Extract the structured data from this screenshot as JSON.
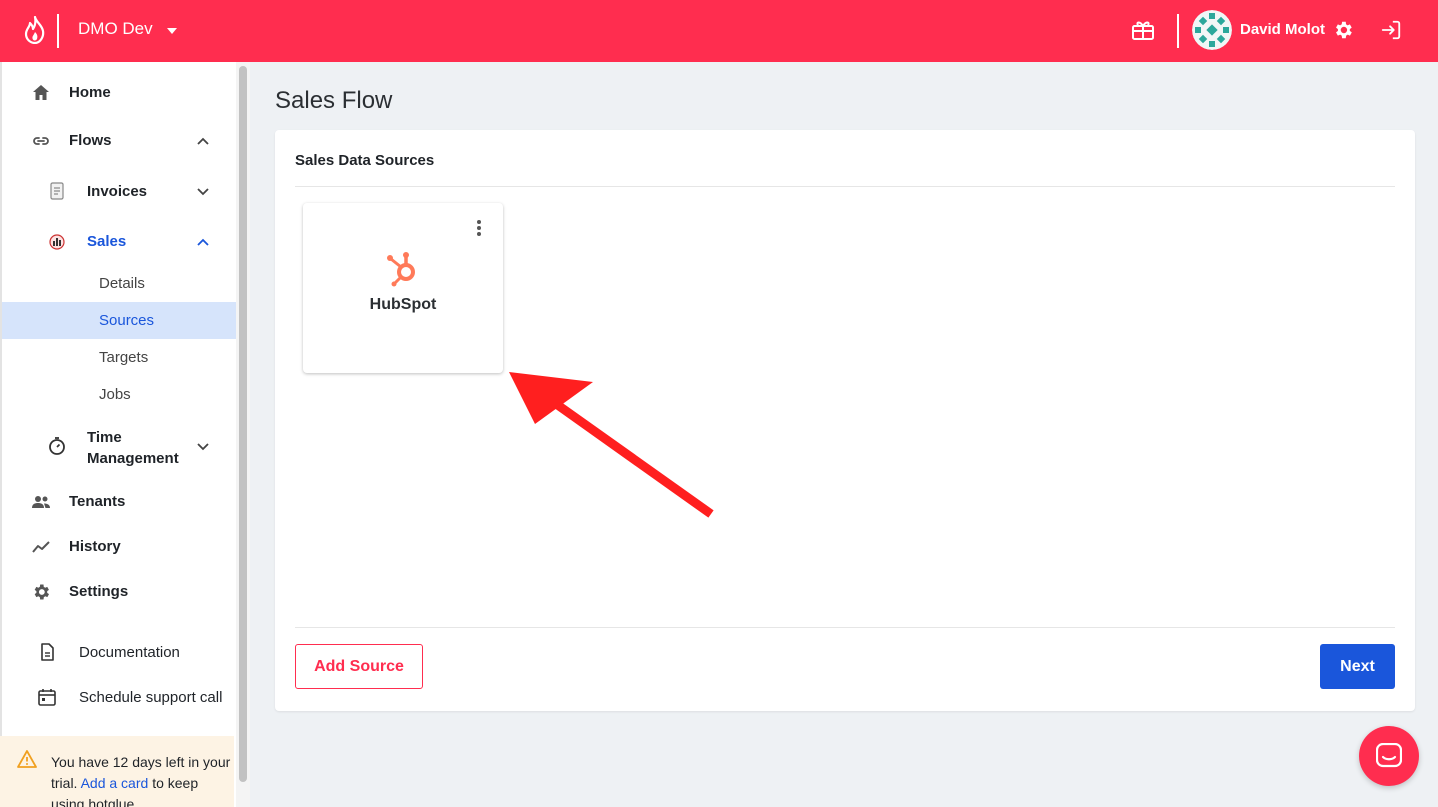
{
  "topbar": {
    "workspace": "DMO Dev",
    "user_name": "David Molot",
    "brand_color": "#ff2d4f"
  },
  "sidebar": {
    "home": "Home",
    "flows": "Flows",
    "invoices": "Invoices",
    "sales": "Sales",
    "sales_sub": [
      "Details",
      "Sources",
      "Targets",
      "Jobs"
    ],
    "active_sub": "Sources",
    "time_management_line1": "Time",
    "time_management_line2": "Management",
    "tenants": "Tenants",
    "history": "History",
    "settings": "Settings",
    "documentation": "Documentation",
    "schedule_support": "Schedule support call",
    "trial_text_before": "You have 12 days left in your trial.",
    "trial_link": "Add a card",
    "trial_text_after": "to keep using hotglue."
  },
  "main": {
    "page_title": "Sales Flow",
    "panel_title": "Sales Data Sources",
    "sources": [
      {
        "name": "HubSpot",
        "icon": "hubspot-icon"
      }
    ],
    "add_source_label": "Add Source",
    "next_label": "Next",
    "accent_color": "#1a56db"
  }
}
